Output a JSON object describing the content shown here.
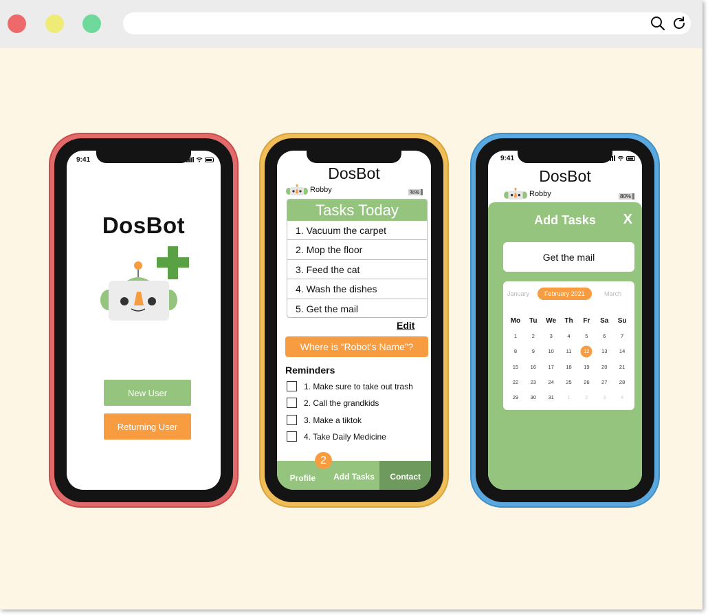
{
  "browser": {
    "search_icon": "search-icon",
    "reload_icon": "reload-icon"
  },
  "phone1": {
    "status_time": "9:41",
    "app_title": "DosBot",
    "new_user_label": "New User",
    "returning_user_label": "Returning User"
  },
  "phone2": {
    "app_title": "DosBot",
    "profile_name": "Robby",
    "battery": "%%",
    "tasks_title": "Tasks Today",
    "tasks": [
      "1. Vacuum the carpet",
      "2. Mop the floor",
      "3. Feed the cat",
      "4. Wash the dishes",
      "5. Get the mail"
    ],
    "edit_label": "Edit",
    "where_button": "Where is “Robot’s Name”?",
    "reminders_title": "Reminders",
    "reminders": [
      "1. Make sure to take out trash",
      "2. Call the grandkids",
      "3. Make a tiktok",
      "4. Take Daily Medicine"
    ],
    "tabs": {
      "profile": "Profile",
      "add_tasks": "Add Tasks",
      "contact": "Contact"
    },
    "badge_count": "2"
  },
  "phone3": {
    "status_time": "9:41",
    "app_title": "DosBot",
    "profile_name": "Robby",
    "battery": "80%",
    "panel_title": "Add Tasks",
    "close_label": "X",
    "task_input_value": "Get the mail",
    "calendar": {
      "prev_month": "January",
      "current_month": "February 2021",
      "next_month": "March",
      "weekdays": [
        "Mo",
        "Tu",
        "We",
        "Th",
        "Fr",
        "Sa",
        "Su"
      ],
      "weeks": [
        [
          "1",
          "2",
          "3",
          "4",
          "5",
          "6",
          "7"
        ],
        [
          "8",
          "9",
          "10",
          "11",
          "12",
          "13",
          "14"
        ],
        [
          "15",
          "16",
          "17",
          "18",
          "19",
          "20",
          "21"
        ],
        [
          "22",
          "23",
          "24",
          "25",
          "26",
          "27",
          "28"
        ],
        [
          "29",
          "30",
          "31",
          "1",
          "2",
          "3",
          "4"
        ]
      ],
      "selected_day": "12"
    }
  },
  "colors": {
    "green": "#94c47d",
    "orange": "#f79c40",
    "background": "#fdf6e4",
    "phone_red": "#e26a6a",
    "phone_yellow": "#efbe58",
    "phone_blue": "#5aa8de"
  }
}
